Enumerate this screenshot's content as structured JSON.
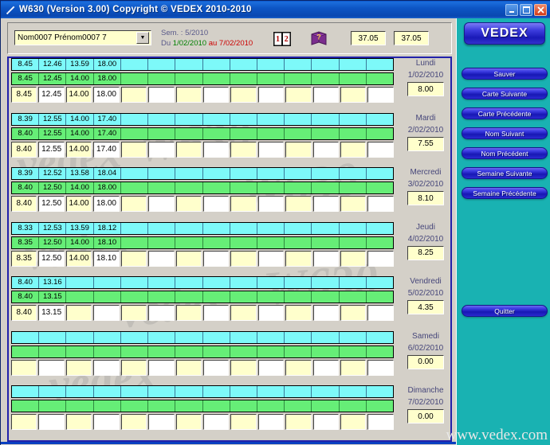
{
  "window": {
    "title": "W630  (Version 3.00)     Copyright ©   VEDEX  2010-2010",
    "sysicon": "pen-icon",
    "minimize_label": "_",
    "maximize_label": "□",
    "close_label": "✕"
  },
  "header": {
    "employee_combo_value": "Nom0007 Prénom0007 7",
    "combo_arrow": "▼",
    "week_label": "Sem. : 5/2010",
    "range_from_prefix": "Du",
    "range_from": "1/02/2010",
    "range_to_prefix": "au",
    "range_to": "7/02/2010",
    "book_icon": "numbered-book-icon",
    "help_icon": "help-book-icon",
    "total_1": "37.05",
    "total_2": "37.05"
  },
  "days": [
    {
      "name": "Lundi",
      "date": "1/02/2010",
      "total": "8.00",
      "cyan": [
        "8.45",
        "12.46",
        "13.59",
        "18.00",
        "",
        "",
        "",
        "",
        "",
        "",
        "",
        "",
        "",
        ""
      ],
      "green": [
        "8.45",
        "12.45",
        "14.00",
        "18.00",
        "",
        "",
        "",
        "",
        "",
        "",
        "",
        "",
        "",
        ""
      ],
      "edit": [
        "8.45",
        "12.45",
        "14.00",
        "18.00",
        "",
        "",
        "",
        "",
        "",
        "",
        "",
        "",
        "",
        ""
      ]
    },
    {
      "name": "Mardi",
      "date": "2/02/2010",
      "total": "7.55",
      "cyan": [
        "8.39",
        "12.55",
        "14.00",
        "17.40",
        "",
        "",
        "",
        "",
        "",
        "",
        "",
        "",
        "",
        ""
      ],
      "green": [
        "8.40",
        "12.55",
        "14.00",
        "17.40",
        "",
        "",
        "",
        "",
        "",
        "",
        "",
        "",
        "",
        ""
      ],
      "edit": [
        "8.40",
        "12.55",
        "14.00",
        "17.40",
        "",
        "",
        "",
        "",
        "",
        "",
        "",
        "",
        "",
        ""
      ]
    },
    {
      "name": "Mercredi",
      "date": "3/02/2010",
      "total": "8.10",
      "cyan": [
        "8.39",
        "12.52",
        "13.58",
        "18.04",
        "",
        "",
        "",
        "",
        "",
        "",
        "",
        "",
        "",
        ""
      ],
      "green": [
        "8.40",
        "12.50",
        "14.00",
        "18.00",
        "",
        "",
        "",
        "",
        "",
        "",
        "",
        "",
        "",
        ""
      ],
      "edit": [
        "8.40",
        "12.50",
        "14.00",
        "18.00",
        "",
        "",
        "",
        "",
        "",
        "",
        "",
        "",
        "",
        ""
      ]
    },
    {
      "name": "Jeudi",
      "date": "4/02/2010",
      "total": "8.25",
      "cyan": [
        "8.33",
        "12.53",
        "13.59",
        "18.12",
        "",
        "",
        "",
        "",
        "",
        "",
        "",
        "",
        "",
        ""
      ],
      "green": [
        "8.35",
        "12.50",
        "14.00",
        "18.10",
        "",
        "",
        "",
        "",
        "",
        "",
        "",
        "",
        "",
        ""
      ],
      "edit": [
        "8.35",
        "12.50",
        "14.00",
        "18.10",
        "",
        "",
        "",
        "",
        "",
        "",
        "",
        "",
        "",
        ""
      ]
    },
    {
      "name": "Vendredi",
      "date": "5/02/2010",
      "total": "4.35",
      "cyan": [
        "8.40",
        "13.16",
        "",
        "",
        "",
        "",
        "",
        "",
        "",
        "",
        "",
        "",
        "",
        ""
      ],
      "green": [
        "8.40",
        "13.15",
        "",
        "",
        "",
        "",
        "",
        "",
        "",
        "",
        "",
        "",
        "",
        ""
      ],
      "edit": [
        "8.40",
        "13.15",
        "",
        "",
        "",
        "",
        "",
        "",
        "",
        "",
        "",
        "",
        "",
        ""
      ]
    },
    {
      "name": "Samedi",
      "date": "6/02/2010",
      "total": "0.00",
      "cyan": [
        "",
        "",
        "",
        "",
        "",
        "",
        "",
        "",
        "",
        "",
        "",
        "",
        "",
        ""
      ],
      "green": [
        "",
        "",
        "",
        "",
        "",
        "",
        "",
        "",
        "",
        "",
        "",
        "",
        "",
        ""
      ],
      "edit": [
        "",
        "",
        "",
        "",
        "",
        "",
        "",
        "",
        "",
        "",
        "",
        "",
        "",
        ""
      ]
    },
    {
      "name": "Dimanche",
      "date": "7/02/2010",
      "total": "0.00",
      "cyan": [
        "",
        "",
        "",
        "",
        "",
        "",
        "",
        "",
        "",
        "",
        "",
        "",
        "",
        ""
      ],
      "green": [
        "",
        "",
        "",
        "",
        "",
        "",
        "",
        "",
        "",
        "",
        "",
        "",
        "",
        ""
      ],
      "edit": [
        "",
        "",
        "",
        "",
        "",
        "",
        "",
        "",
        "",
        "",
        "",
        "",
        "",
        ""
      ]
    }
  ],
  "sidebar": {
    "logo": "VEDEX",
    "buttons": [
      "Sauver",
      "Carte Suivante",
      "Carte Précédente",
      "Nom Suivant",
      "Nom Précédent",
      "Semaine Suivante",
      "Semaine Précédente"
    ],
    "quit": "Quitter"
  },
  "watermark": {
    "url": "www.vedex.com",
    "words": [
      "vedex",
      "W630",
      "vedex",
      "W630",
      "vedex",
      "W630",
      "vedex"
    ]
  },
  "colors": {
    "cyan_row": "#7df9f9",
    "green_row": "#66ee77",
    "yellow_cell": "#ffffcc",
    "white_cell": "#ffffff",
    "sidebar_bg": "#19b2b2",
    "button_blue": "#2a2ad0",
    "titlebar_blue": "#0d55c4",
    "grid_border": "#2222aa",
    "label_text": "#46467a",
    "du_green": "#008000",
    "au_red": "#cc0000"
  }
}
